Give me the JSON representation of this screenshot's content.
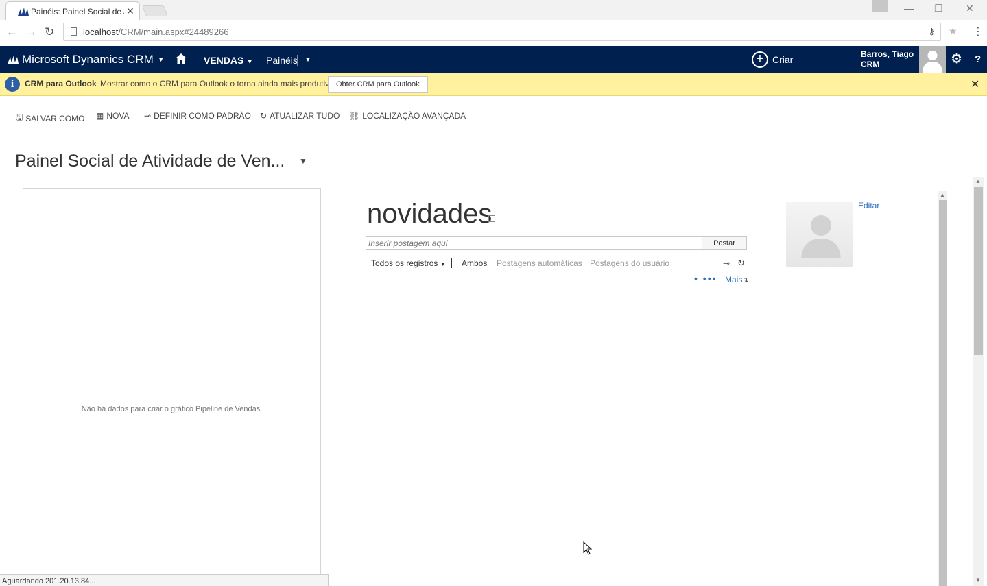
{
  "browser": {
    "tab_title": "Painéis: Painel Social de A",
    "url_host": "localhost",
    "url_path": "/CRM/main.aspx#24489266"
  },
  "crm_nav": {
    "app_name": "Microsoft Dynamics CRM",
    "area": "VENDAS",
    "sub_area": "Painéis",
    "create_label": "Criar",
    "user_name": "Barros, Tiago",
    "user_org": "CRM",
    "help_label": "?",
    "brand_color": "#002050"
  },
  "notification": {
    "title": "CRM para Outlook",
    "message": "Mostrar como o CRM para Outlook o torna ainda mais produtivo.",
    "button": "Obter CRM para Outlook",
    "background": "#fff19d"
  },
  "commands": {
    "save_as": "SALVAR COMO",
    "new": "NOVA",
    "set_default": "DEFINIR COMO PADRÃO",
    "refresh_all": "ATUALIZAR TUDO",
    "advanced_find": "LOCALIZAÇÃO AVANÇADA"
  },
  "dashboard": {
    "title": "Painel Social de Atividade de Ven..."
  },
  "chart_panel": {
    "no_data_message": "Não há dados para criar o gráfico Pipeline de Vendas."
  },
  "social": {
    "title": "novidades",
    "post_placeholder": "Inserir postagem aqui",
    "post_button": "Postar",
    "filter_records": "Todos os registros",
    "filter_both": "Ambos",
    "filter_auto": "Postagens automáticas",
    "filter_user": "Postagens do usuário",
    "more_dots": "• •••",
    "more_label": "Mais",
    "edit_label": "Editar",
    "link_color": "#2a6ebb"
  },
  "status_bar": {
    "text": "Aguardando 201.20.13.84..."
  }
}
